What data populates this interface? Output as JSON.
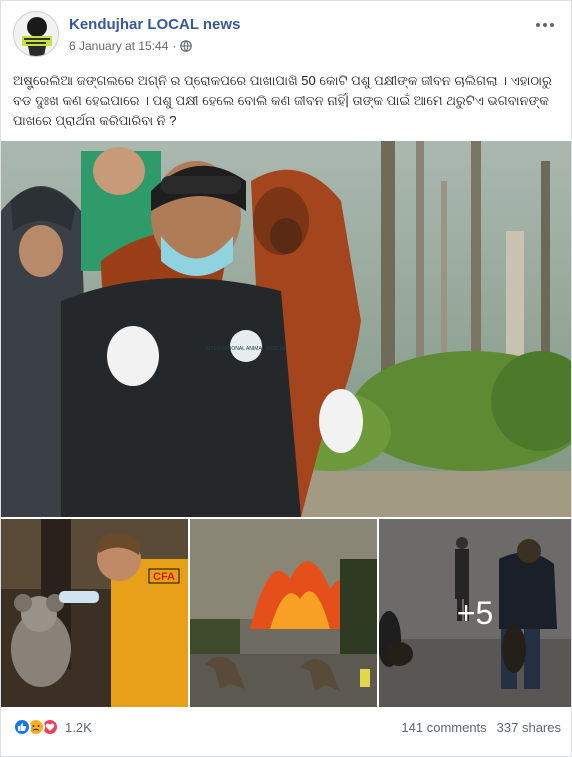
{
  "post": {
    "page_name": "Kendujhar LOCAL news",
    "timestamp": "6 January at 15:44",
    "text": "ଅଷ୍ଟ୍ରେଲିଆ ଜଙ୍ଗଲରେ ଅଗ୍ନି ର ପ୍ରୋକପରେ ପାଖାପାଖି 50 କୋଟି ପଶୁ ପକ୍ଷୀଙ୍କ ଜୀବନ ଚାଲିଗଲା । ଏହାଠାରୁ ବଡ ଦୁଃଖ କଣ ହେଇପାରେ । ପଶୁ ପକ୍ଷୀ ହେଲେ ବୋଲି କଣ ଜୀବନ ନାହିଁ| ତାଙ୍କ ପାଇଁ ଆମେ ଥରୁଟିଏ ଭଗବାନଙ୍କ ପାଖରେ ପ୍ରାର୍ଥନା କରିପାରିବା ନି ?",
    "more_photos_label": "+5",
    "avatar_icon": "page-logo-icon",
    "shirt_text": "INTERNATIONAL ANIMAL RESCUE",
    "jacket_text": "CFA"
  },
  "footer": {
    "reaction_count": "1.2K",
    "comments": "141 comments",
    "shares": "337 shares",
    "reaction_icons": [
      "like-icon",
      "sad-icon",
      "love-icon"
    ]
  },
  "colors": {
    "link": "#385898",
    "meta": "#606770",
    "like": "#1877f2",
    "sad": "#f7b125",
    "love": "#f33e58"
  }
}
